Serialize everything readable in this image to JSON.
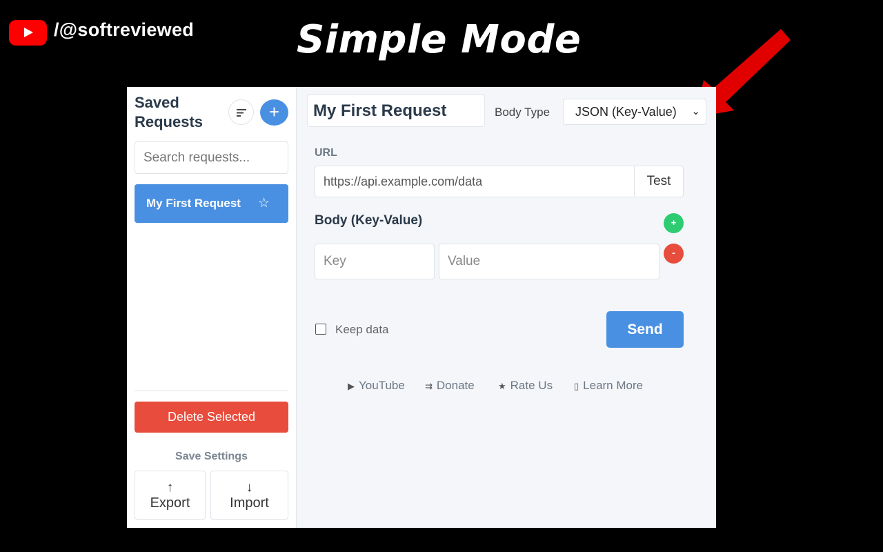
{
  "overlay": {
    "channel_handle": "/@softreviewed",
    "headline": "Simple Mode",
    "youtube_logo_color": "#ff0000",
    "arrow_color": "#e00000"
  },
  "sidebar": {
    "title_line1": "Saved",
    "title_line2": "Requests",
    "sort_icon": "sort-lines-icon",
    "add_icon": "plus-icon",
    "add_label": "+",
    "search_placeholder": "Search requests...",
    "items": [
      {
        "label": "My First Request",
        "selected": true,
        "favorite_icon": "☆"
      }
    ],
    "delete_label": "Delete Selected",
    "save_settings_label": "Save Settings",
    "export": {
      "arrow": "↑",
      "label": "Export"
    },
    "import": {
      "arrow": "↓",
      "label": "Import"
    }
  },
  "main": {
    "request_name": "My First Request",
    "body_type_label": "Body Type",
    "body_type_value": "JSON (Key-Value)",
    "body_type_chevron": "⌄",
    "url_label": "URL",
    "url_value": "https://api.example.com/data",
    "test_label": "Test",
    "body_section_title": "Body (Key-Value)",
    "add_row_label": "+",
    "remove_row_label": "-",
    "key_placeholder": "Key",
    "value_placeholder": "Value",
    "keep_data_label": "Keep data",
    "keep_data_checked": false,
    "send_label": "Send",
    "footer_links": [
      {
        "icon": "▶",
        "label": "YouTube"
      },
      {
        "icon": "⇉",
        "label": "Donate"
      },
      {
        "icon": "★",
        "label": "Rate Us"
      },
      {
        "icon": "▯",
        "label": "Learn More"
      }
    ]
  },
  "colors": {
    "accent_blue": "#4a90e2",
    "danger_red": "#e74c3c",
    "success_green": "#2ecc71",
    "panel_bg": "#f4f6f9"
  }
}
